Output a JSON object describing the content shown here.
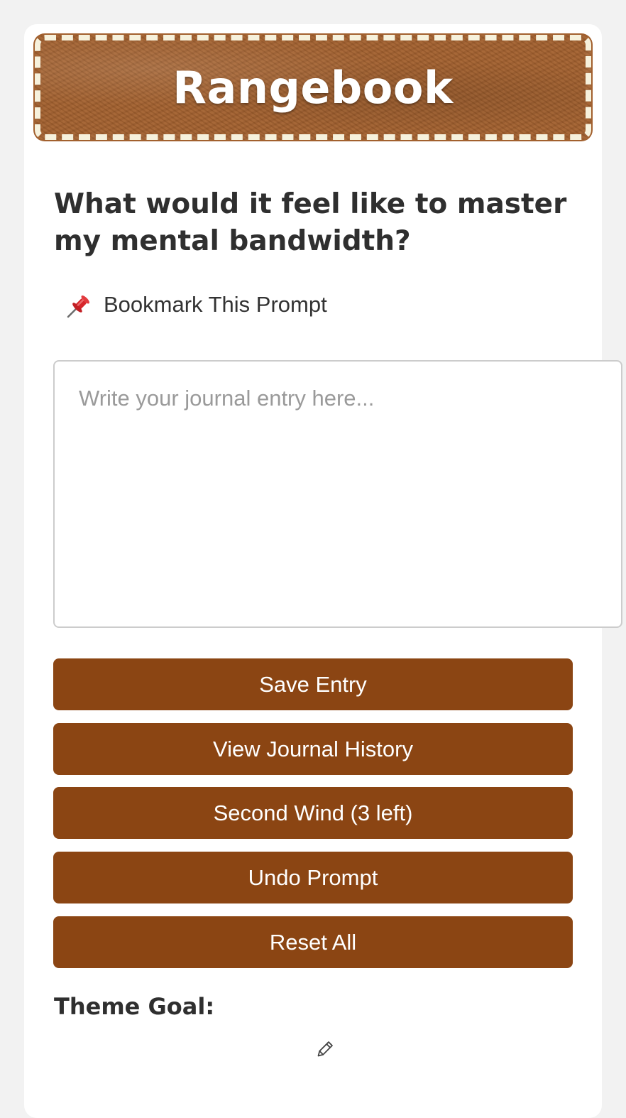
{
  "app": {
    "title": "Rangebook"
  },
  "prompt": {
    "question": "What would it feel like to master my mental bandwidth?"
  },
  "bookmark": {
    "icon": "pushpin-icon",
    "label": "Bookmark This Prompt"
  },
  "journal": {
    "value": "",
    "placeholder": "Write your journal entry here..."
  },
  "actions": {
    "save_label": "Save Entry",
    "history_label": "View Journal History",
    "second_wind_label": "Second Wind (3 left)",
    "undo_label": "Undo Prompt",
    "reset_label": "Reset All"
  },
  "theme": {
    "label": "Theme Goal:",
    "edit_icon": "pencil-icon"
  },
  "colors": {
    "header_leather": "#a2602e",
    "stitching": "#f6f1dc",
    "button": "#8b4513",
    "button_text": "#ffffff",
    "page_background": "#f2f2f2"
  }
}
